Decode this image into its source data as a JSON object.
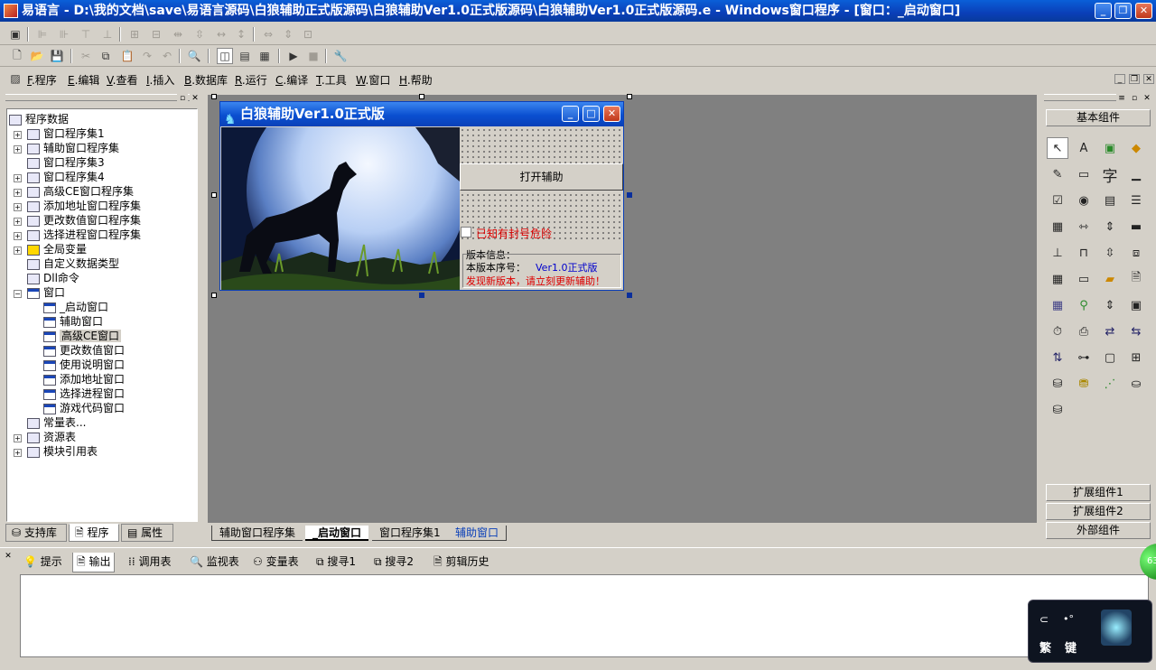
{
  "window": {
    "title": "易语言 - D:\\我的文档\\save\\易语言源码\\白狼辅助正式版源码\\白狼辅助Ver1.0正式版源码\\白狼辅助Ver1.0正式版源码.e - Windows窗口程序 - [窗口：_启动窗口]"
  },
  "menu": [
    {
      "key": "F",
      "label": ".程序"
    },
    {
      "key": "E",
      "label": ".编辑"
    },
    {
      "key": "V",
      "label": ".查看"
    },
    {
      "key": "I",
      "label": ".插入"
    },
    {
      "key": "B",
      "label": ".数据库"
    },
    {
      "key": "R",
      "label": ".运行"
    },
    {
      "key": "C",
      "label": ".编译"
    },
    {
      "key": "T",
      "label": ".工具"
    },
    {
      "key": "W",
      "label": ".窗口"
    },
    {
      "key": "H",
      "label": ".帮助"
    }
  ],
  "tree": {
    "root": "程序数据",
    "items": [
      "窗口程序集1",
      "辅助窗口程序集",
      "窗口程序集3",
      "窗口程序集4",
      "高级CE窗口程序集",
      "添加地址窗口程序集",
      "更改数值窗口程序集",
      "选择进程窗口程序集",
      "全局变量",
      "自定义数据类型",
      "Dll命令",
      "窗口"
    ],
    "windows": [
      "_启动窗口",
      "辅助窗口",
      "高级CE窗口",
      "更改数值窗口",
      "使用说明窗口",
      "添加地址窗口",
      "选择进程窗口",
      "游戏代码窗口"
    ],
    "tail": [
      "常量表...",
      "资源表",
      "模块引用表"
    ]
  },
  "left_tabs": [
    "支持库",
    "程序",
    "属性"
  ],
  "form": {
    "title": "白狼辅助Ver1.0正式版",
    "open_button": "打开辅助",
    "checkbox": "已知有封号危险",
    "info_title": "版本信息：",
    "version_label": "本版本序号：",
    "version_value": "Ver1.0正式版",
    "update_notice": "发现新版本，请立刻更新辅助！"
  },
  "design_tabs": [
    "辅助窗口程序集",
    "_启动窗口",
    "窗口程序集1",
    "辅助窗口"
  ],
  "right_panel": {
    "basic": "基本组件",
    "ext1": "扩展组件1",
    "ext2": "扩展组件2",
    "external": "外部组件"
  },
  "output_tabs": [
    "提示",
    "输出",
    "调用表",
    "监视表",
    "变量表",
    "搜寻1",
    "搜寻2",
    "剪辑历史"
  ],
  "ime": {
    "traditional": "繁",
    "key": "键"
  },
  "indicator": "63"
}
